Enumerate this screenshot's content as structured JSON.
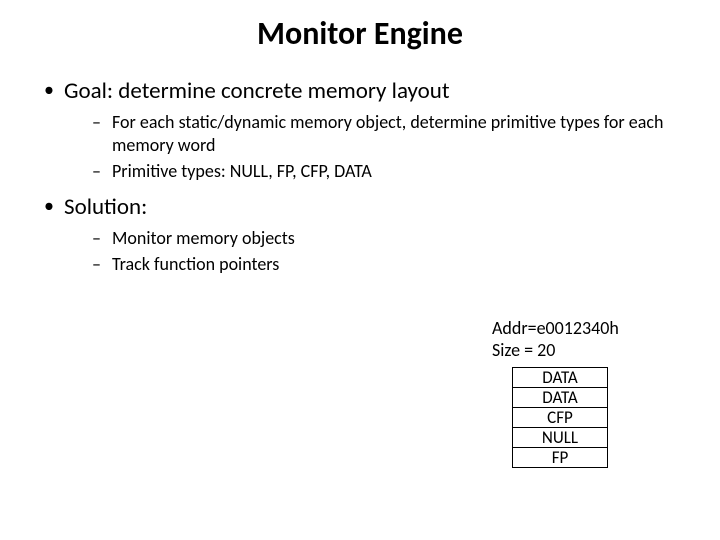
{
  "title": "Monitor Engine",
  "bullets": [
    {
      "text": "Goal: determine concrete memory layout",
      "sub": [
        "For each static/dynamic memory object, determine primitive types for each memory word",
        "Primitive types: NULL, FP, CFP, DATA"
      ]
    },
    {
      "text": "Solution:",
      "sub": [
        "Monitor memory objects",
        "Track function pointers"
      ]
    }
  ],
  "memory": {
    "addr_label": "Addr=e0012340h",
    "size_label": "Size = 20",
    "cells": [
      "DATA",
      "DATA",
      "CFP",
      "NULL",
      "FP"
    ]
  }
}
